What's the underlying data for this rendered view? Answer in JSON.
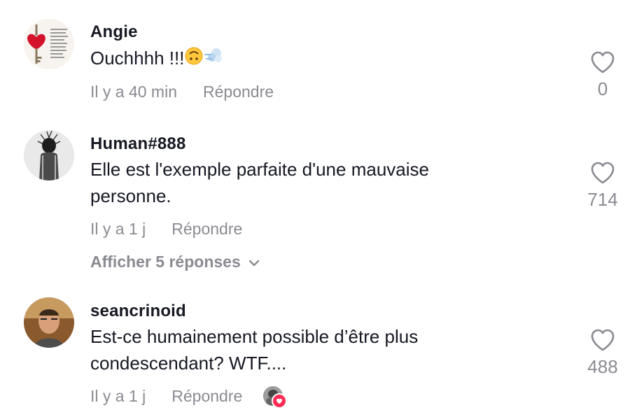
{
  "comments": [
    {
      "username": "Angie",
      "text": "Ouchhhh !!!",
      "emojis": [
        "upside-down-face",
        "dash-symbol"
      ],
      "time": "Il y a 40 min",
      "reply_label": "Répondre",
      "likes": "0"
    },
    {
      "username": "Human#888",
      "text": "Elle est l'exemple parfaite d'une mauvaise personne.",
      "time": "Il y a 1 j",
      "reply_label": "Répondre",
      "likes": "714",
      "view_replies": "Afficher 5 réponses"
    },
    {
      "username": "seancrinoid",
      "text": "Est-ce humainement possible d’être plus condescendant? WTF....",
      "time": "Il y a 1 j",
      "reply_label": "Répondre",
      "likes": "488",
      "liked_by_creator": true
    }
  ],
  "colors": {
    "text": "#161823",
    "muted": "#8a8b91",
    "accent": "#fe2c55"
  }
}
